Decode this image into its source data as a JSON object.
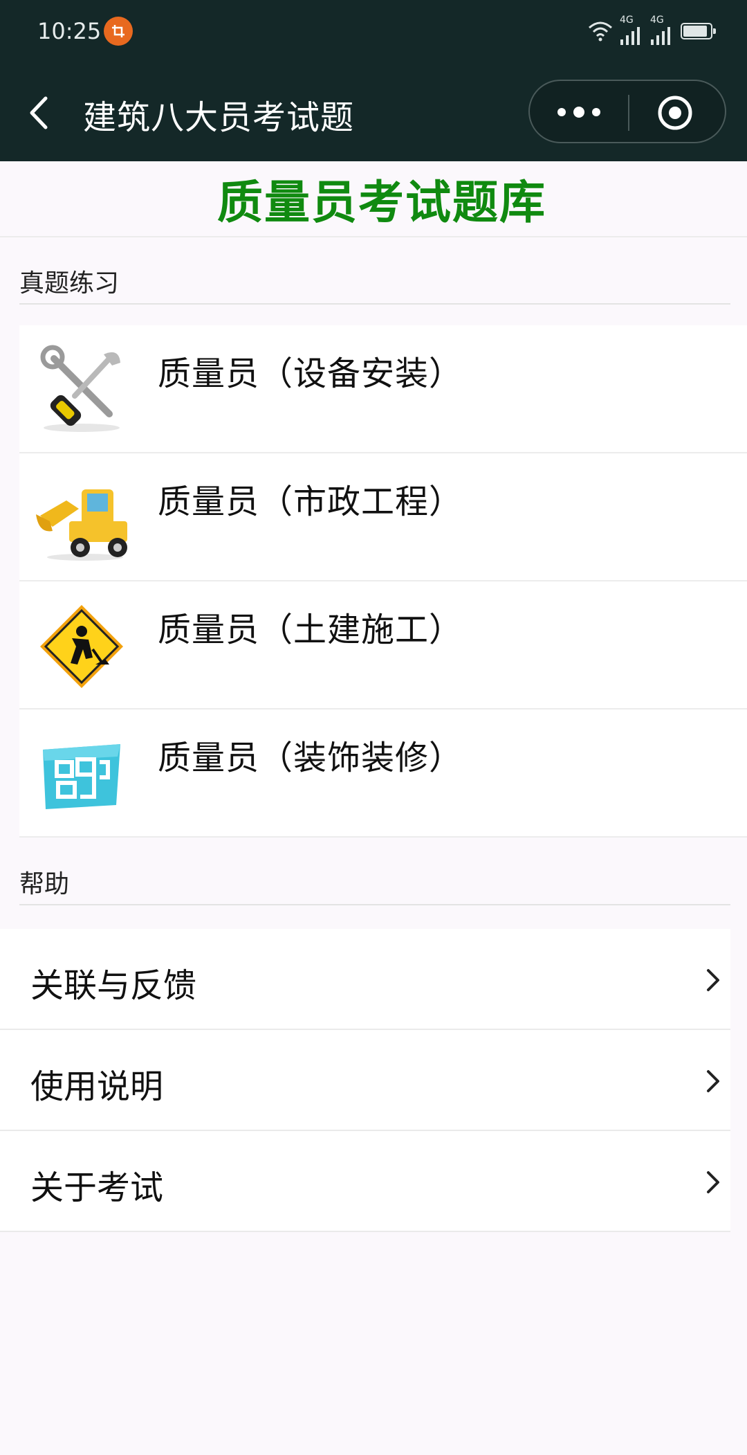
{
  "status_bar": {
    "time": "10:25",
    "network_1": "4G",
    "network_2": "4G"
  },
  "nav": {
    "title": "建筑八大员考试题"
  },
  "banner": {
    "title": "质量员考试题库"
  },
  "practice": {
    "heading": "真题练习",
    "items": [
      {
        "label": "质量员（设备安装）",
        "icon": "tools-icon"
      },
      {
        "label": "质量员（市政工程）",
        "icon": "excavator-icon"
      },
      {
        "label": "质量员（土建施工）",
        "icon": "road-work-sign-icon"
      },
      {
        "label": "质量员（装饰装修）",
        "icon": "floor-plan-icon"
      }
    ]
  },
  "help": {
    "heading": "帮助",
    "items": [
      {
        "label": "关联与反馈"
      },
      {
        "label": "使用说明"
      },
      {
        "label": "关于考试"
      }
    ]
  },
  "colors": {
    "nav_bg": "#142828",
    "banner_title": "#108a10",
    "page_bg": "#fbf8fc"
  }
}
